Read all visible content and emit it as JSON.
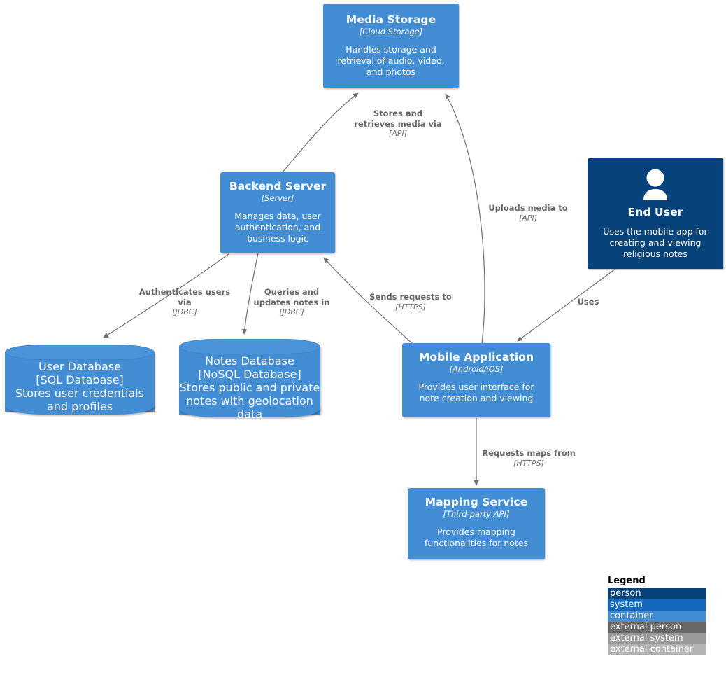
{
  "diagram": {
    "type": "c4-container-diagram",
    "colors": {
      "person": "#08427b",
      "system": "#1168bd",
      "container": "#438dd5",
      "external_person": "#686868",
      "external_system": "#999999",
      "external_container": "#b3b3b3",
      "edge": "#707070",
      "edge_label": "#666666",
      "background": "#ffffff"
    }
  },
  "nodes": [
    {
      "id": "media-storage",
      "kind": "container",
      "shape": "rect",
      "title": "Media Storage",
      "tech": "[Cloud Storage]",
      "desc": "Handles storage and retrieval of audio, video, and photos"
    },
    {
      "id": "backend-server",
      "kind": "container",
      "shape": "rect",
      "title": "Backend Server",
      "tech": "[Server]",
      "desc": "Manages data, user authentication, and business logic"
    },
    {
      "id": "end-user",
      "kind": "person",
      "shape": "rect",
      "title": "End User",
      "tech": "",
      "desc": "Uses the mobile app for creating and viewing religious notes"
    },
    {
      "id": "user-database",
      "kind": "container",
      "shape": "cylinder",
      "title": "User Database",
      "tech": "[SQL Database]",
      "desc": "Stores user credentials and profiles"
    },
    {
      "id": "notes-database",
      "kind": "container",
      "shape": "cylinder",
      "title": "Notes Database",
      "tech": "[NoSQL Database]",
      "desc": "Stores public and private notes with geolocation data"
    },
    {
      "id": "mobile-application",
      "kind": "container",
      "shape": "rect",
      "title": "Mobile Application",
      "tech": "[Android/iOS]",
      "desc": "Provides user interface for note creation and viewing"
    },
    {
      "id": "mapping-service",
      "kind": "container",
      "shape": "rect",
      "title": "Mapping Service",
      "tech": "[Third-party API]",
      "desc": "Provides mapping functionalities for notes"
    }
  ],
  "edges": [
    {
      "id": "backend-to-media",
      "from": "backend-server",
      "to": "media-storage",
      "label": "Stores and retrieves media via",
      "label_line1": "Stores and",
      "label_line2": "retrieves media via",
      "tech": "[API]"
    },
    {
      "id": "mobile-to-media",
      "from": "mobile-application",
      "to": "media-storage",
      "label": "Uploads media to",
      "label_line1": "Uploads media to",
      "label_line2": "",
      "tech": "[API]"
    },
    {
      "id": "backend-to-userdb",
      "from": "backend-server",
      "to": "user-database",
      "label": "Authenticates users via",
      "label_line1": "Authenticates users",
      "label_line2": "via",
      "tech": "[JDBC]"
    },
    {
      "id": "backend-to-notesdb",
      "from": "backend-server",
      "to": "notes-database",
      "label": "Queries and updates notes in",
      "label_line1": "Queries and",
      "label_line2": "updates notes in",
      "tech": "[JDBC]"
    },
    {
      "id": "mobile-to-backend",
      "from": "mobile-application",
      "to": "backend-server",
      "label": "Sends requests to",
      "label_line1": "Sends requests to",
      "label_line2": "",
      "tech": "[HTTPS]"
    },
    {
      "id": "enduser-to-mobile",
      "from": "end-user",
      "to": "mobile-application",
      "label": "Uses",
      "label_line1": "Uses",
      "label_line2": "",
      "tech": ""
    },
    {
      "id": "mobile-to-mapping",
      "from": "mobile-application",
      "to": "mapping-service",
      "label": "Requests maps from",
      "label_line1": "Requests maps from",
      "label_line2": "",
      "tech": "[HTTPS]"
    }
  ],
  "legend": {
    "title": "Legend",
    "items": [
      {
        "label": "person",
        "color": "#08427b"
      },
      {
        "label": "system",
        "color": "#1168bd"
      },
      {
        "label": "container",
        "color": "#438dd5"
      },
      {
        "label": "external person",
        "color": "#686868"
      },
      {
        "label": "external system",
        "color": "#999999"
      },
      {
        "label": "external container",
        "color": "#b3b3b3"
      }
    ]
  }
}
